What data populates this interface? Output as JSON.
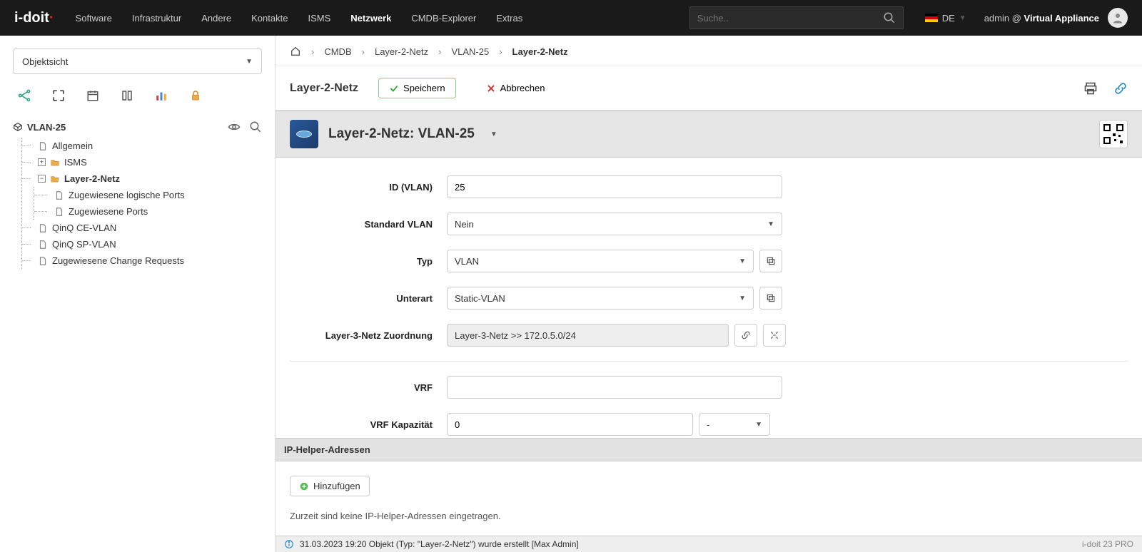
{
  "topbar": {
    "logo": "i-doit",
    "menu": [
      "Software",
      "Infrastruktur",
      "Andere",
      "Kontakte",
      "ISMS",
      "Netzwerk",
      "CMDB-Explorer",
      "Extras"
    ],
    "menu_active": 5,
    "search_placeholder": "Suche..",
    "lang": "DE",
    "user_prefix": "admin @ ",
    "user_bold": "Virtual Appliance"
  },
  "sidebar": {
    "view_select": "Objektsicht",
    "root": "VLAN-25",
    "items": {
      "allgemein": "Allgemein",
      "isms": "ISMS",
      "l2": "Layer-2-Netz",
      "l2_sub1": "Zugewiesene logische Ports",
      "l2_sub2": "Zugewiesene Ports",
      "qinq_ce": "QinQ CE-VLAN",
      "qinq_sp": "QinQ SP-VLAN",
      "change_req": "Zugewiesene Change Requests"
    }
  },
  "breadcrumb": {
    "i1": "CMDB",
    "i2": "Layer-2-Netz",
    "i3": "VLAN-25",
    "cur": "Layer-2-Netz"
  },
  "actions": {
    "title": "Layer-2-Netz",
    "save": "Speichern",
    "cancel": "Abbrechen"
  },
  "obj_header": {
    "title": "Layer-2-Netz: VLAN-25"
  },
  "form": {
    "f1_label": "ID (VLAN)",
    "f1_value": "25",
    "f2_label": "Standard VLAN",
    "f2_value": "Nein",
    "f3_label": "Typ",
    "f3_value": "VLAN",
    "f4_label": "Unterart",
    "f4_value": "Static-VLAN",
    "f5_label": "Layer-3-Netz Zuordnung",
    "f5_value": "Layer-3-Netz >> 172.0.5.0/24",
    "f6_label": "VRF",
    "f6_value": "",
    "f7_label": "VRF Kapazität",
    "f7_value": "0",
    "f7_unit": "-"
  },
  "ip_helper": {
    "heading": "IP-Helper-Adressen",
    "add": "Hinzufügen",
    "empty": "Zurzeit sind keine IP-Helper-Adressen eingetragen."
  },
  "footer": {
    "msg": "31.03.2023 19:20 Objekt (Typ: \"Layer-2-Netz\") wurde erstellt [Max Admin]",
    "right": "i-doit 23 PRO"
  }
}
